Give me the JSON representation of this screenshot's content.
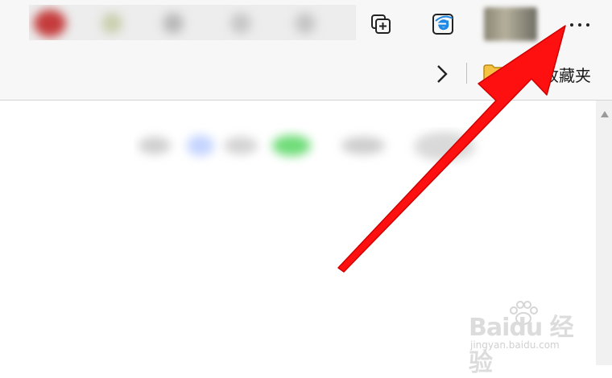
{
  "toolbar": {
    "favorites_label": "收藏夹",
    "icons": {
      "collections": "collections-icon",
      "ie_mode": "ie-mode-icon",
      "more": "more-options-icon",
      "chevron": "chevron-right-icon",
      "folder": "folder-icon"
    }
  },
  "watermark": {
    "brand": "Baidu 经验",
    "url": "jingyan.baidu.com"
  },
  "colors": {
    "arrow": "#ff1010",
    "folder": "#f5c242",
    "ie_blue": "#1e88e5"
  }
}
